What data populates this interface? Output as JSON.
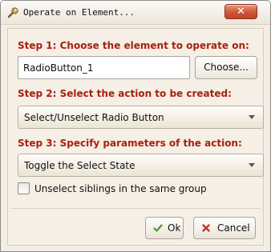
{
  "window": {
    "title": "Operate on Element...",
    "close_glyph": "✕",
    "icon": "wrench-icon"
  },
  "step1": {
    "label": "Step 1: Choose the element to operate on:",
    "element_value": "RadioButton_1",
    "choose_label": "Choose..."
  },
  "step2": {
    "label": "Step 2: Select the action to be created:",
    "action_value": "Select/Unselect Radio Button"
  },
  "step3": {
    "label": "Step 3: Specify parameters of the action:",
    "param_value": "Toggle the Select State",
    "checkbox_label": "Unselect siblings in the same group",
    "checkbox_checked": false
  },
  "buttons": {
    "ok_label": "Ok",
    "cancel_label": "Cancel"
  },
  "colors": {
    "step_label": "#a8200d",
    "close_button": "#d0553a",
    "ok_check": "#4a9a2a",
    "cancel_x": "#c0392b"
  }
}
